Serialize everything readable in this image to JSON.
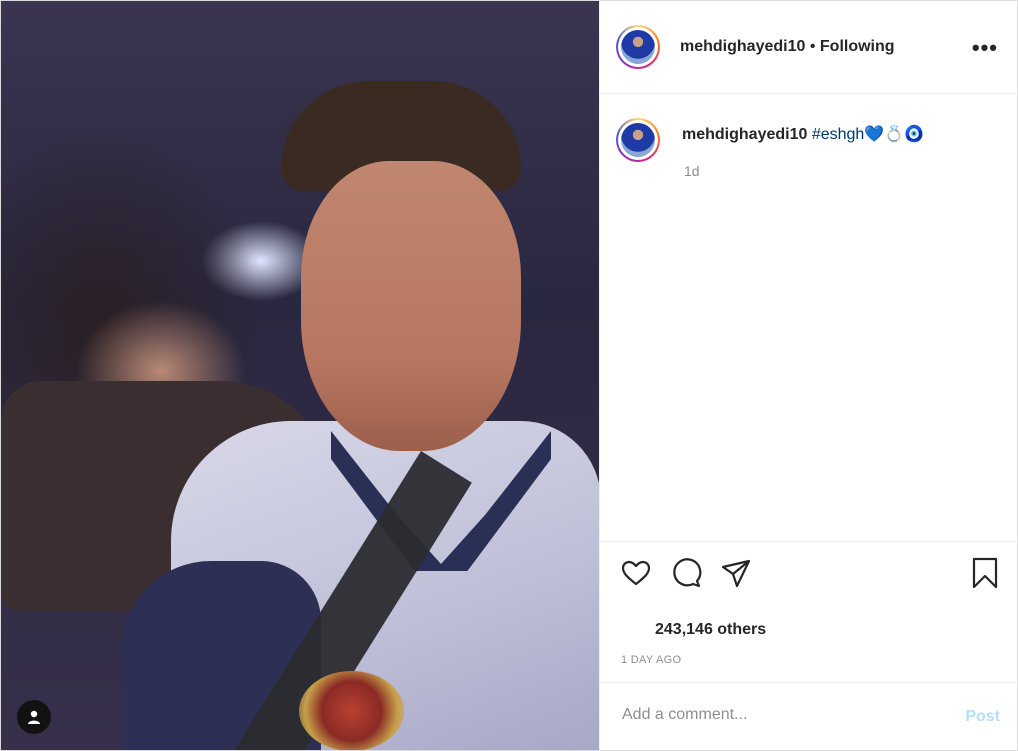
{
  "post": {
    "username": "mehdighayedi10",
    "separator": "•",
    "follow_status": "Following",
    "caption_user": "mehdighayedi10",
    "caption_hashtag": "#eshgh",
    "caption_emojis": "💙💍🧿",
    "age": "1d",
    "likes": "243,146 others",
    "date": "1 DAY AGO"
  },
  "comment": {
    "placeholder": "Add a comment...",
    "post_label": "Post"
  },
  "icons": {
    "more": "more-options-icon",
    "like": "heart-icon",
    "comment": "comment-icon",
    "share": "send-icon",
    "save": "bookmark-icon",
    "tagged": "user-tag-icon"
  },
  "colors": {
    "text": "#262626",
    "muted": "#8e8e8e",
    "hashtag": "#00376b",
    "post_disabled": "#b2dffc"
  }
}
